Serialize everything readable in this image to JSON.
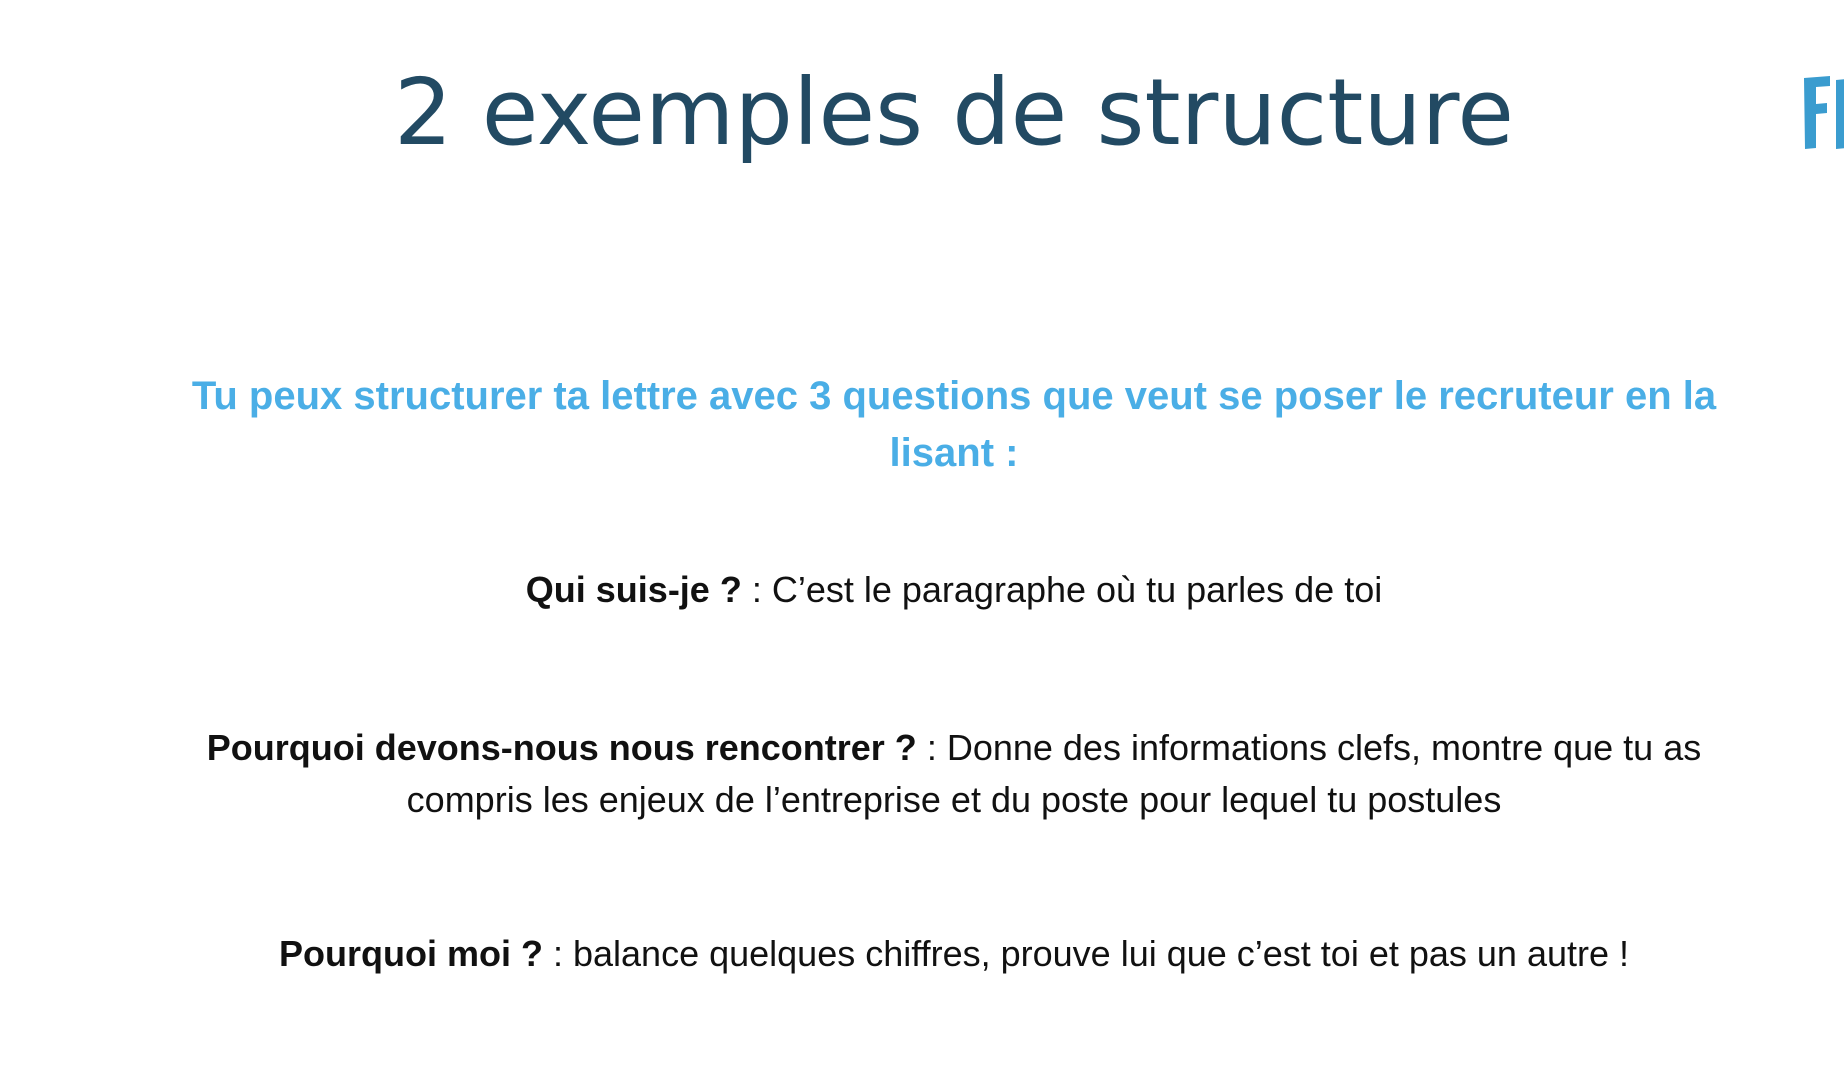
{
  "slide": {
    "title": "2 exemples de structure",
    "subtitle": "Tu peux structurer ta lettre avec 3 questions que veut se poser le recruteur en la lisant :",
    "items": [
      {
        "question": "Qui suis-je ?",
        "answer": " : C’est le paragraphe où tu parles de toi"
      },
      {
        "question": "Pourquoi devons-nous nous rencontrer ?",
        "answer": " : Donne des informations clefs, montre que tu as compris les enjeux de l’entreprise et du poste pour lequel tu postules"
      },
      {
        "question": "Pourquoi moi ?",
        "answer": " : balance quelques chiffres, prouve lui que c’est toi et pas un autre !"
      }
    ],
    "logo_icon": "logo-fragment-icon"
  },
  "colors": {
    "title": "#224a63",
    "subtitle": "#4aaee6",
    "body_text": "#111111",
    "logo": "#3a9ccf",
    "background": "#ffffff"
  }
}
